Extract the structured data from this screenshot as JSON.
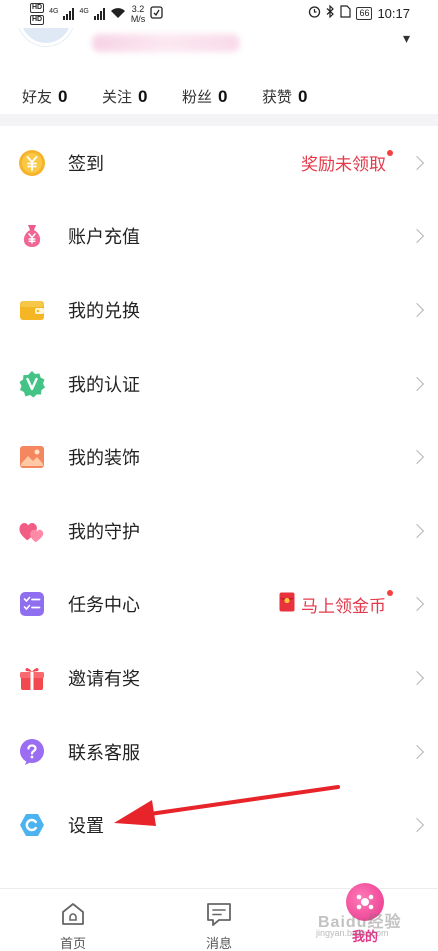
{
  "status_bar": {
    "network_tags": [
      "HD",
      "HD"
    ],
    "signal_labels": [
      "4G",
      "4G"
    ],
    "speed_value": "3.2",
    "speed_unit": "M/s",
    "battery": "66",
    "time": "10:17"
  },
  "stats": [
    {
      "label": "好友",
      "value": "0"
    },
    {
      "label": "关注",
      "value": "0"
    },
    {
      "label": "粉丝",
      "value": "0"
    },
    {
      "label": "获赞",
      "value": "0"
    }
  ],
  "menu": [
    {
      "label": "签到",
      "icon": "coin-yuan-icon",
      "extra": "奖励未领取",
      "dot": true
    },
    {
      "label": "账户充值",
      "icon": "money-bag-icon",
      "extra": "",
      "dot": false
    },
    {
      "label": "我的兑换",
      "icon": "wallet-icon",
      "extra": "",
      "dot": false
    },
    {
      "label": "我的认证",
      "icon": "verified-badge-icon",
      "extra": "",
      "dot": false
    },
    {
      "label": "我的装饰",
      "icon": "picture-icon",
      "extra": "",
      "dot": false
    },
    {
      "label": "我的守护",
      "icon": "hearts-icon",
      "extra": "",
      "dot": false
    },
    {
      "label": "任务中心",
      "icon": "checklist-icon",
      "extra": "马上领金币",
      "dot": true
    },
    {
      "label": "邀请有奖",
      "icon": "gift-icon",
      "extra": "",
      "dot": false
    },
    {
      "label": "联系客服",
      "icon": "help-icon",
      "extra": "",
      "dot": false
    },
    {
      "label": "设置",
      "icon": "settings-hex-icon",
      "extra": "",
      "dot": false
    }
  ],
  "tabs": [
    {
      "label": "首页",
      "icon": "home-icon"
    },
    {
      "label": "消息",
      "icon": "message-icon"
    },
    {
      "label": "我的",
      "icon": "profile-avatar-icon"
    }
  ],
  "watermark": "Baidu经验",
  "watermark_sub": "jingyan.baidu.com",
  "colors": {
    "accent_red": "#e4394a",
    "tab_active": "#e8348a",
    "annotation_arrow": "#e8242b"
  }
}
